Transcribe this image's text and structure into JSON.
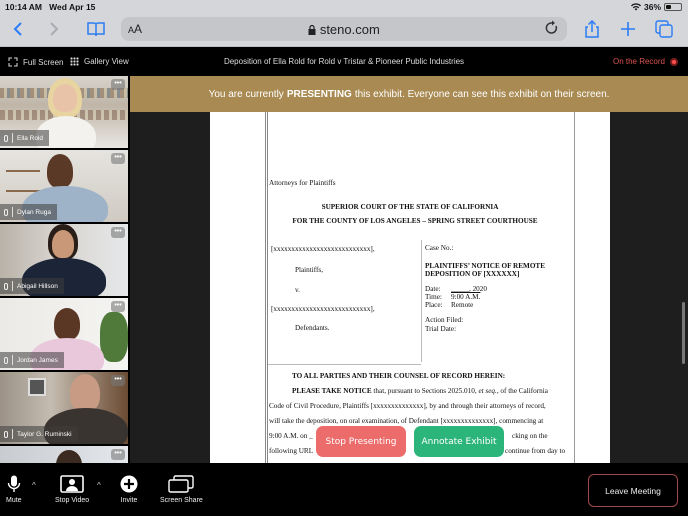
{
  "status_bar": {
    "time": "10:14 AM",
    "date": "Wed Apr 15",
    "battery_percent_label": "36%",
    "battery_level": 0.36,
    "icons": [
      "wifi-icon",
      "battery-icon"
    ]
  },
  "browser": {
    "text_size_label_small": "A",
    "text_size_label_large": "A",
    "url": "steno.com",
    "icons": [
      "back-icon",
      "forward-icon",
      "bookmarks-icon",
      "lock-icon",
      "reload-icon",
      "share-icon",
      "new-tab-icon",
      "tabs-icon"
    ]
  },
  "app_header": {
    "full_screen_label": "Full Screen",
    "gallery_view_label": "Gallery View",
    "title": "Deposition of Ella Rold for Rold v Tristar & Pioneer Public Industries",
    "record_status": "On the Record",
    "colors": {
      "record": "#d9534f"
    }
  },
  "participants": [
    {
      "name": "Ella Rold"
    },
    {
      "name": "Dylan Ruga"
    },
    {
      "name": "Abigail Hillson"
    },
    {
      "name": "Jordan James"
    },
    {
      "name": "Taylor G. Ruminski"
    },
    {
      "name": ""
    }
  ],
  "banner": {
    "prefix": "You are currently",
    "emphasis": "PRESENTING",
    "suffix": "this exhibit. Everyone can see this exhibit on their screen.",
    "color": "#a98a52"
  },
  "document": {
    "attorneys": "Attorneys for Plaintiffs",
    "court_line1": "SUPERIOR COURT OF THE STATE OF CALIFORNIA",
    "court_line2": "FOR THE COUNTY OF LOS ANGELES – SPRING STREET COURTHOUSE",
    "plaintiff_placeholder": "[xxxxxxxxxxxxxxxxxxxxxxxxxxx],",
    "plaintiffs_label": "Plaintiffs,",
    "versus": "v.",
    "defendant_placeholder": "[xxxxxxxxxxxxxxxxxxxxxxxxxxx],",
    "defendants_label": "Defendants.",
    "case_no": "Case No.:",
    "notice_title_1": "PLAINTIFFS’ NOTICE OF REMOTE",
    "notice_title_2": "DEPOSITION OF [XXXXXX]",
    "date_label": "Date:",
    "date_value": "_____, 2020",
    "time_label": "Time:",
    "time_value": "9:00 A.M.",
    "place_label": "Place:",
    "place_value": "Remote",
    "action_filed": "Action Filed:",
    "trial_date": "Trial Date:",
    "to_all": "TO ALL PARTIES AND THEIR COUNSEL OF RECORD HEREIN:",
    "please_take_notice": "PLEASE TAKE NOTICE",
    "body_line1_rest": " that, pursuant to Sections 2025.010, ",
    "body_line1_italic": "et seq.",
    "body_line1_end": ", of the California",
    "body_line2": "Code of Civil Procedure, Plaintiffs [xxxxxxxxxxxxxx], by and through their attorneys of record,",
    "body_line3": "will take the deposition, on oral examination, of Defendant [xxxxxxxxxxxxxx], commencing at",
    "body_line4_start": "9:00 A.M. on _",
    "body_line4_end": "cking on the",
    "body_line5_start": "following URL",
    "body_line5_end": "continue from day to"
  },
  "actions": {
    "stop_presenting": "Stop Presenting",
    "annotate_exhibit": "Annotate Exhibit",
    "colors": {
      "stop": "#ec6b6b",
      "annotate": "#2cb57b"
    }
  },
  "toolbar": {
    "mute": "Mute",
    "stop_video": "Stop Video",
    "invite": "Invite",
    "screen_share": "Screen Share",
    "leave_meeting": "Leave Meeting"
  }
}
